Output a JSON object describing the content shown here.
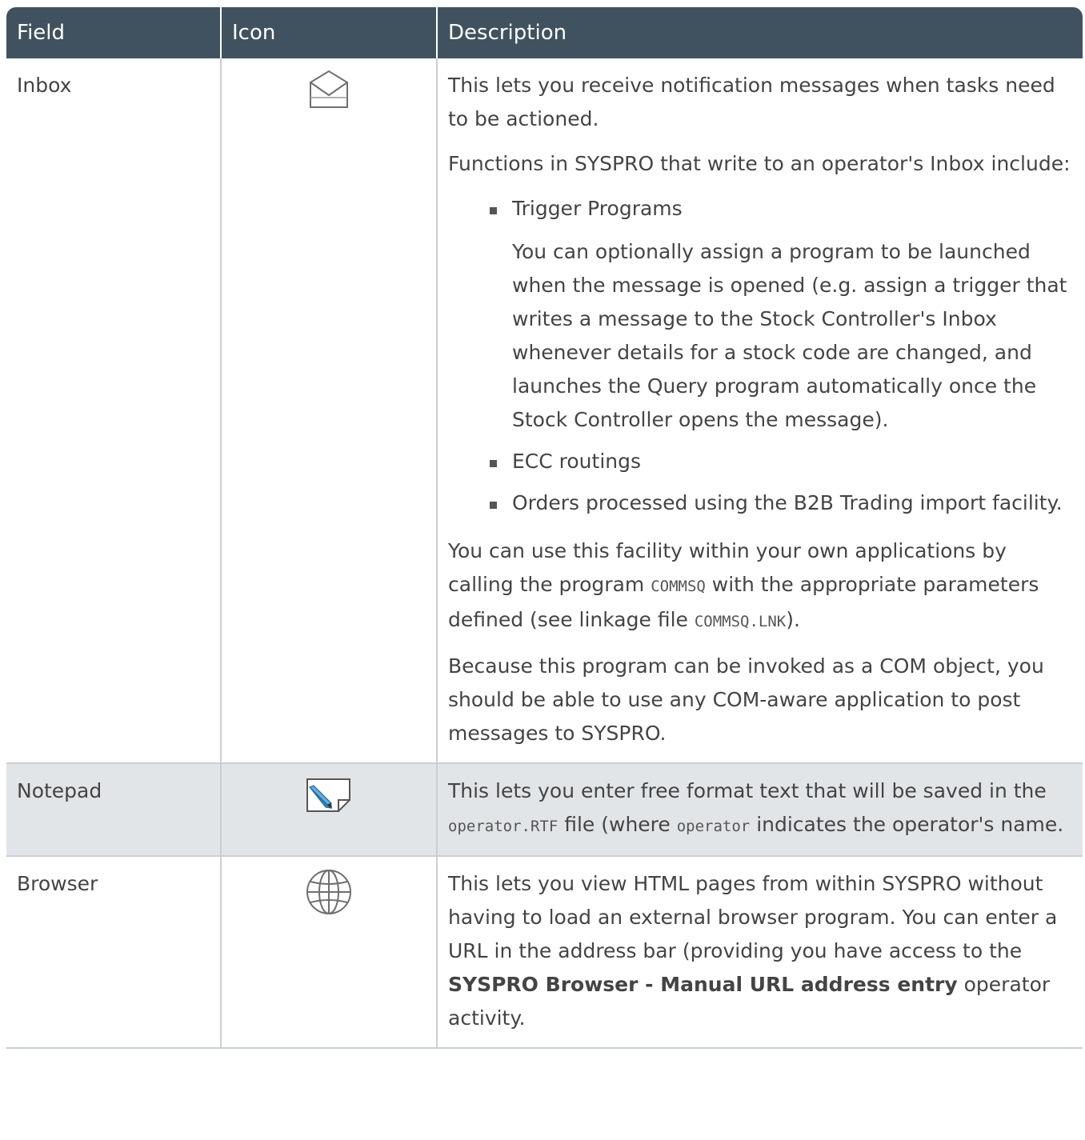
{
  "header": {
    "field": "Field",
    "icon": "Icon",
    "description": "Description"
  },
  "rows": {
    "inbox": {
      "field": "Inbox",
      "icon": "envelope-open-icon",
      "p1": "This lets you receive notification messages when tasks need to be actioned.",
      "p2": "Functions in SYSPRO that write to an operator's Inbox include:",
      "bullet1": "Trigger Programs",
      "bullet1_sub": "You can optionally assign a program to be launched when the message is opened (e.g. assign a trigger that writes a message to the Stock Controller's Inbox whenever details for a stock code are changed, and launches the Query program automatically once the Stock Controller opens the message).",
      "bullet2": "ECC routings",
      "bullet3": "Orders processed using the B2B Trading import facility.",
      "p3_a": "You can use this facility within your own applications by calling the program ",
      "p3_code1": "COMMSQ",
      "p3_b": " with the appropriate parameters defined (see linkage file ",
      "p3_code2": "COMMSQ.LNK",
      "p3_c": ").",
      "p4": "Because this program can be invoked as a COM object, you should be able to use any COM-aware application to post messages to SYSPRO."
    },
    "notepad": {
      "field": "Notepad",
      "icon": "notepad-pencil-icon",
      "d_a": "This lets you enter free format text that will be saved in the ",
      "d_code1": "operator.RTF",
      "d_b": " file (where ",
      "d_code2": "operator",
      "d_c": " indicates the operator's name."
    },
    "browser": {
      "field": "Browser",
      "icon": "globe-icon",
      "d_a": "This lets you view HTML pages from within SYSPRO without having to load an external browser program. You can enter a URL in the address bar (providing you have access to the ",
      "d_strong": "SYSPRO Browser - Manual URL address entry",
      "d_b": " operator activity."
    }
  },
  "colors": {
    "header_bg": "#40525f",
    "shaded_row": "#e2e5e8",
    "text": "#444444",
    "border": "#c9cfd4"
  }
}
